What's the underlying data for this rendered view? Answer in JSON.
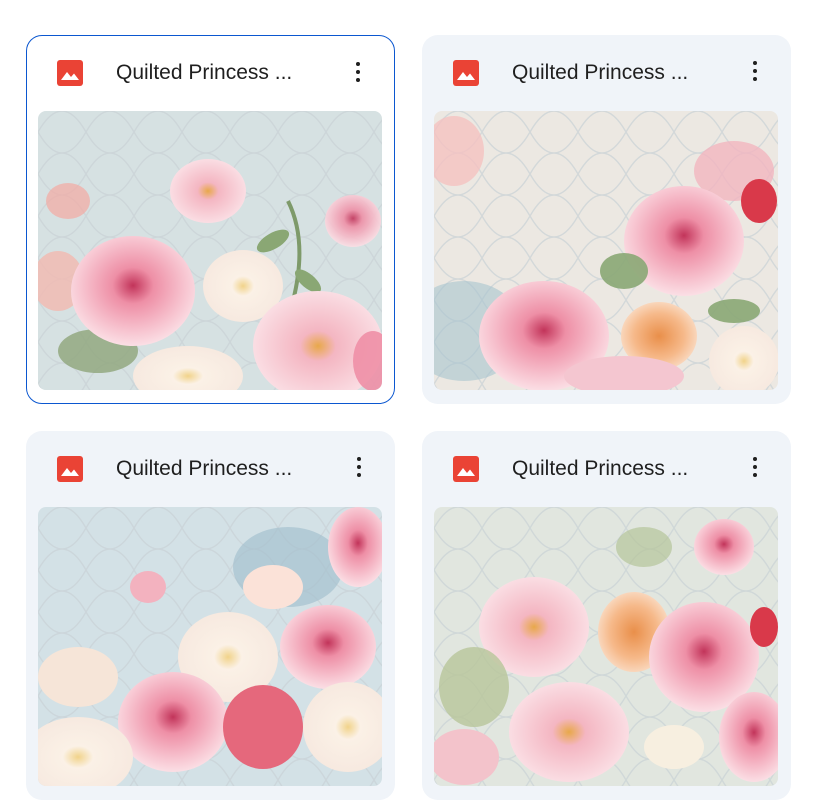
{
  "files": [
    {
      "title": "Quilted Princess ...",
      "icon": "image-icon",
      "selected": true
    },
    {
      "title": "Quilted Princess ...",
      "icon": "image-icon",
      "selected": false
    },
    {
      "title": "Quilted Princess ...",
      "icon": "image-icon",
      "selected": false
    },
    {
      "title": "Quilted Princess ...",
      "icon": "image-icon",
      "selected": false
    }
  ],
  "colors": {
    "card_bg": "#f0f4f9",
    "selected_border": "#0b57d0",
    "image_icon": "#ea4335",
    "title_text": "#1f1f1f"
  }
}
